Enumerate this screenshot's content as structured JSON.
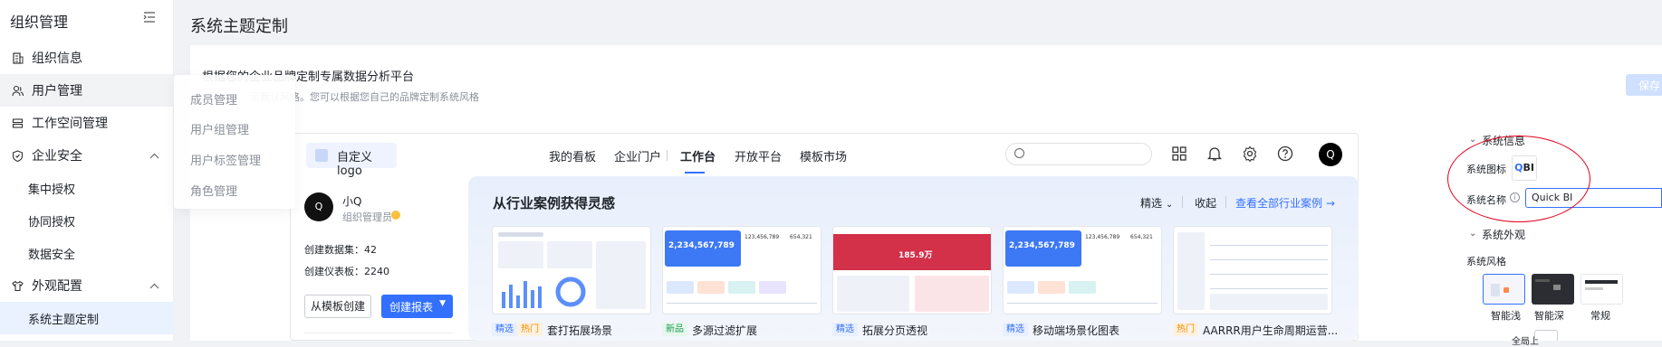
{
  "sidebar": {
    "title": "组织管理",
    "items": [
      {
        "label": "组织信息",
        "icon": "building-icon"
      },
      {
        "label": "用户管理",
        "icon": "users-icon"
      },
      {
        "label": "工作空间管理",
        "icon": "database-icon"
      },
      {
        "label": "企业安全",
        "icon": "shield-icon"
      },
      {
        "label": "集中授权"
      },
      {
        "label": "协同授权"
      },
      {
        "label": "数据安全"
      },
      {
        "label": "外观配置",
        "icon": "shirt-icon"
      },
      {
        "label": "系统主题定制"
      }
    ]
  },
  "popover": {
    "items": [
      "成员管理",
      "用户组管理",
      "用户标签管理",
      "角色管理"
    ]
  },
  "header": {
    "title": "系统主题定制",
    "subtitle": "根据您的企业品牌定制专属数据分析平台",
    "desc": "示默认风格。您可以根据您自己的品牌定制系统风格",
    "save": "保存"
  },
  "preview": {
    "logo_label": "自定义logo",
    "nav": [
      "我的看板",
      "企业门户",
      "工作台",
      "开放平台",
      "模板市场"
    ],
    "avatar": "Q",
    "user": {
      "avatar": "Q",
      "name": "小Q",
      "role": "组织管理员"
    },
    "stats": [
      {
        "label": "创建数据集：",
        "value": "42"
      },
      {
        "label": "创建仪表板：",
        "value": "2240"
      }
    ],
    "btn_template": "从模板创建",
    "btn_create": "创建报表",
    "inspiration": {
      "title": "从行业案例获得灵感",
      "filter": "精选",
      "collapse": "收起",
      "view_all": "查看全部行业案例 →",
      "cases": [
        {
          "tags": [
            {
              "text": "精选",
              "kind": "sel"
            },
            {
              "text": "热门",
              "kind": "hot"
            }
          ],
          "title": "套打拓展场景"
        },
        {
          "tags": [
            {
              "text": "新品",
              "kind": "new"
            }
          ],
          "title": "多源过滤扩展"
        },
        {
          "tags": [
            {
              "text": "精选",
              "kind": "sel"
            }
          ],
          "title": "拓展分页透视"
        },
        {
          "tags": [
            {
              "text": "精选",
              "kind": "sel"
            }
          ],
          "title": "移动端场景化图表"
        },
        {
          "tags": [
            {
              "text": "热门",
              "kind": "hot"
            }
          ],
          "title": "AARRR用户生命周期运营..."
        }
      ],
      "thumb_numbers": [
        "2,234,567,789",
        "123,456,789",
        "654,321",
        "185.9万",
        "2,234,567,789",
        "123,456,789",
        "654,321"
      ]
    }
  },
  "right_panel": {
    "sys_info": "系统信息",
    "sys_icon_label": "系统图标",
    "logo_text_q": "Q",
    "logo_text_bi": "BI",
    "sys_name_label": "系统名称",
    "sys_name_value": "Quick BI",
    "sys_appearance": "系统外观",
    "sys_style": "系统风格",
    "styles": [
      "智能浅",
      "智能深",
      "常规"
    ],
    "cut_label": "全局上"
  },
  "colors": {
    "accent": "#3370ff",
    "annotation": "#e4001b"
  }
}
